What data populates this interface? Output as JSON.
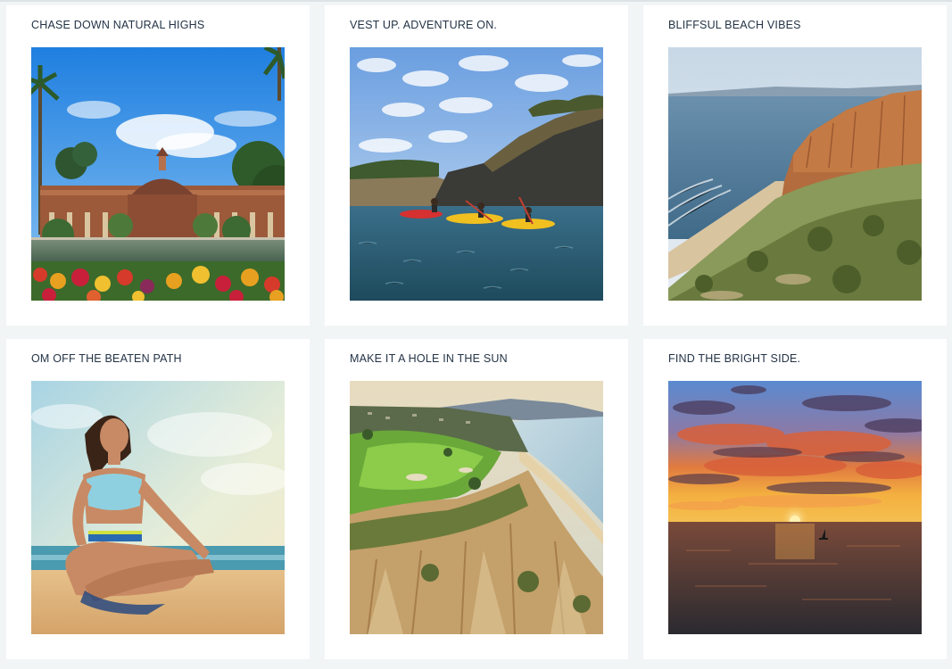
{
  "cards": [
    {
      "title": "CHASE DOWN NATURAL HIGHS",
      "image": "botanical-building-palm-garden"
    },
    {
      "title": "VEST UP. ADVENTURE ON.",
      "image": "kayaks-near-sea-cliffs"
    },
    {
      "title": "BLIFFSUL BEACH VIBES",
      "image": "coastal-bluffs-beach"
    },
    {
      "title": "OM OFF THE BEATEN PATH",
      "image": "woman-meditating-on-beach"
    },
    {
      "title": "MAKE IT A HOLE IN THE SUN",
      "image": "cliffside-golf-course"
    },
    {
      "title": "FIND THE BRIGHT SIDE.",
      "image": "ocean-sunset-sailboat"
    }
  ]
}
